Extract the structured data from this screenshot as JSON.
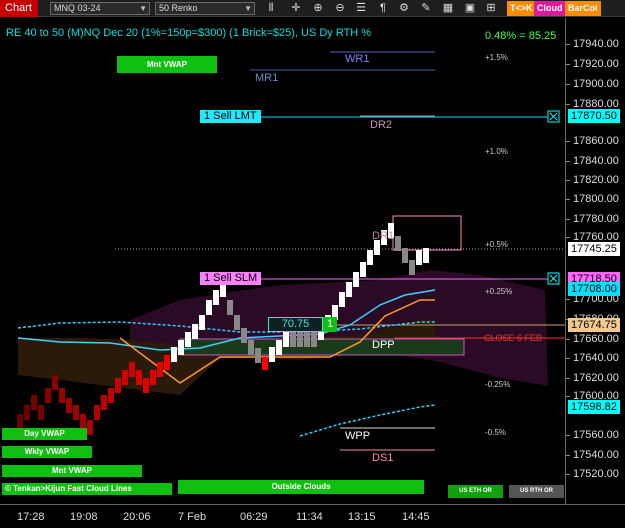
{
  "toolbar": {
    "chart_tab": "Chart",
    "instrument": "MNQ 03-24",
    "bar_type": "50 Renko",
    "buttons": {
      "tk": "T<>K",
      "cloud": "Cloud",
      "barcol": "BarCol"
    },
    "icons": [
      "bars-icon",
      "crosshair-icon",
      "zoom-in-icon",
      "zoom-out-icon",
      "properties-icon",
      "text-icon",
      "strategy-icon",
      "draw-icon",
      "grid-icon",
      "screen-icon"
    ]
  },
  "chart": {
    "title": "RE 40 to 50 (M)NQ Dec 20 (1%=150p=$300) (1 Brick=$25), US Dy RTH %",
    "pct_summary": "0.48% = 85.25",
    "y_ticks": [
      "17940.00",
      "17920.00",
      "17900.00",
      "17880.00",
      "17860.00",
      "17840.00",
      "17820.00",
      "17800.00",
      "17780.00",
      "17760.00",
      "17700.00",
      "17680.00",
      "17660.00",
      "17640.00",
      "17620.00",
      "17600.00",
      "17560.00",
      "17540.00",
      "17520.00"
    ],
    "x_ticks": [
      "17:28",
      "19:08",
      "20:06",
      "7 Feb",
      "06:29",
      "11:34",
      "13:15",
      "14:45"
    ],
    "price_flags": [
      {
        "value": "17870.50",
        "color": "#00ffff"
      },
      {
        "value": "17745.25",
        "color": "#ffffff"
      },
      {
        "value": "17718.50",
        "color": "#ff66ff"
      },
      {
        "value": "17708.00",
        "color": "#00e0ff"
      },
      {
        "value": "17674.75",
        "color": "#f0c890"
      },
      {
        "value": "17598.82",
        "color": "#00ffff"
      }
    ],
    "levels": {
      "wr1": "WR1",
      "mr1": "MR1",
      "dr2": "DR2",
      "dr1": "DR1",
      "dpp": "DPP",
      "wpp": "WPP",
      "ds1": "DS1",
      "close": "CLOSE 6 FEB"
    },
    "pct_labels": [
      "+1.5%",
      "+1.0%",
      "+0.5%",
      "+0.25%",
      "-0.25%",
      "-0.5%"
    ],
    "orders": {
      "sell_lmt": "1 Sell LMT",
      "sell_slm": "1 Sell SLM"
    },
    "value_box": "70.75",
    "count_box": "1",
    "green_labels": {
      "mnt_vwap_top": "Mnt VWAP",
      "day_vwap": "Day VWAP",
      "wkly_vwap": "Wkly VWAP",
      "mnt_vwap": "Mnt VWAP",
      "tenkan": "© Tenkan>Kijun Fast Cloud Lines",
      "outside": "Outside Clouds"
    },
    "status_buttons": {
      "eth": "US ETH OR",
      "rth": "US RTH OR"
    }
  }
}
